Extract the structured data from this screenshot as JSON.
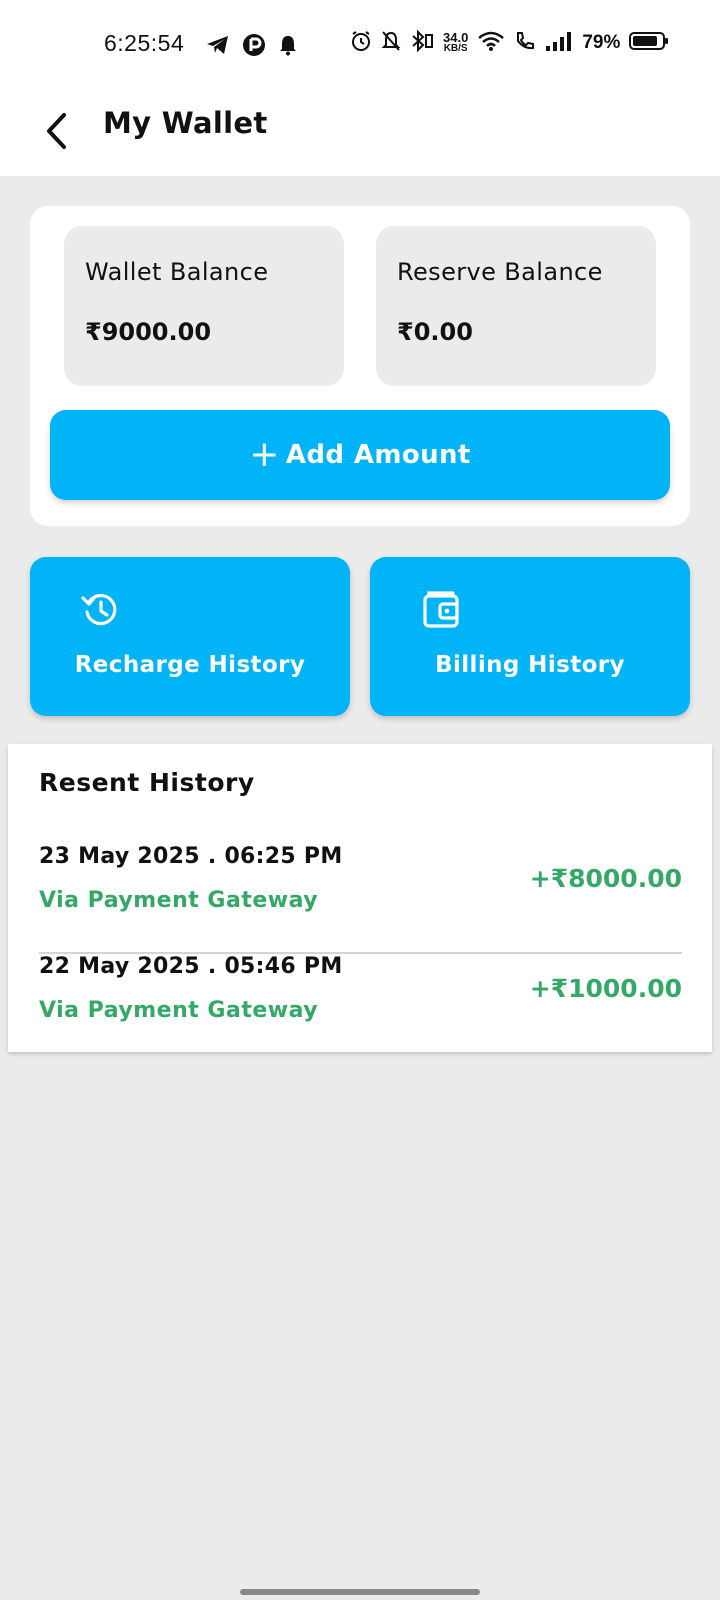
{
  "status_bar": {
    "time": "6:25:54",
    "net_speed_value": "34.0",
    "net_speed_unit": "KB/S",
    "battery": "79%",
    "left_icons": [
      "telegram-icon",
      "app-notification-icon",
      "bell-icon"
    ],
    "right_icons": [
      "alarm-icon",
      "bell-off-icon",
      "bluetooth-icon",
      "wifi-icon",
      "wifi-calling-icon",
      "signal-icon",
      "battery-icon"
    ]
  },
  "header": {
    "title": "My Wallet",
    "back_icon": "chevron-left-icon"
  },
  "balances": {
    "wallet_label": "Wallet Balance",
    "wallet_value": "₹9000.00",
    "reserve_label": "Reserve Balance",
    "reserve_value": "₹0.00"
  },
  "add_amount": {
    "plus": "+",
    "label": "Add Amount"
  },
  "actions": {
    "recharge_label": "Recharge History",
    "recharge_icon": "history-icon",
    "billing_label": "Billing History",
    "billing_icon": "wallet-icon"
  },
  "recent": {
    "title": "Resent History",
    "transactions": [
      {
        "date": "23 May 2025 . 06:25 PM",
        "method": "Via Payment Gateway",
        "amount": "+₹8000.00"
      },
      {
        "date": "22 May 2025 . 05:46 PM",
        "method": "Via Payment Gateway",
        "amount": "+₹1000.00"
      }
    ]
  },
  "colors": {
    "accent": "#00b4f7",
    "positive": "#34a867",
    "background": "#ebebeb",
    "card": "#ffffff"
  }
}
